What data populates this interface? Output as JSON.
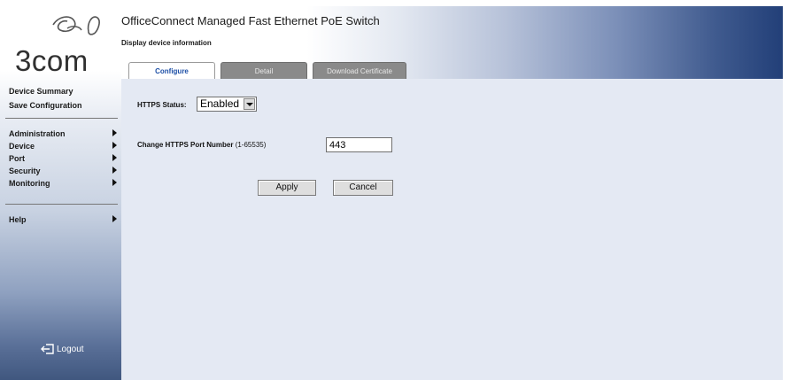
{
  "brand": {
    "wordmark": "3com"
  },
  "sidebar": {
    "quick_links": [
      {
        "label": "Device Summary"
      },
      {
        "label": "Save Configuration"
      }
    ],
    "menu": [
      {
        "label": "Administration"
      },
      {
        "label": "Device"
      },
      {
        "label": "Port"
      },
      {
        "label": "Security"
      },
      {
        "label": "Monitoring"
      }
    ],
    "help": {
      "label": "Help"
    },
    "logout": {
      "label": "Logout",
      "icon": "logout-icon"
    }
  },
  "header": {
    "title": "OfficeConnect Managed Fast Ethernet PoE Switch",
    "subtitle": "Display device information",
    "tabs": [
      {
        "label": "Configure",
        "active": true
      },
      {
        "label": "Detail",
        "active": false
      },
      {
        "label": "Download Certificate",
        "active": false
      }
    ]
  },
  "form": {
    "https_status_label": "HTTPS Status:",
    "https_status_value": "Enabled",
    "port_label": "Change HTTPS Port Number",
    "port_range": "(1-65535)",
    "port_value": "443",
    "apply_label": "Apply",
    "cancel_label": "Cancel"
  },
  "colors": {
    "header_dark": "#223f78",
    "content_bg": "#e4e9f3",
    "active_tab_text": "#1d4fa6",
    "inactive_tab_bg": "#8a8a8a"
  }
}
